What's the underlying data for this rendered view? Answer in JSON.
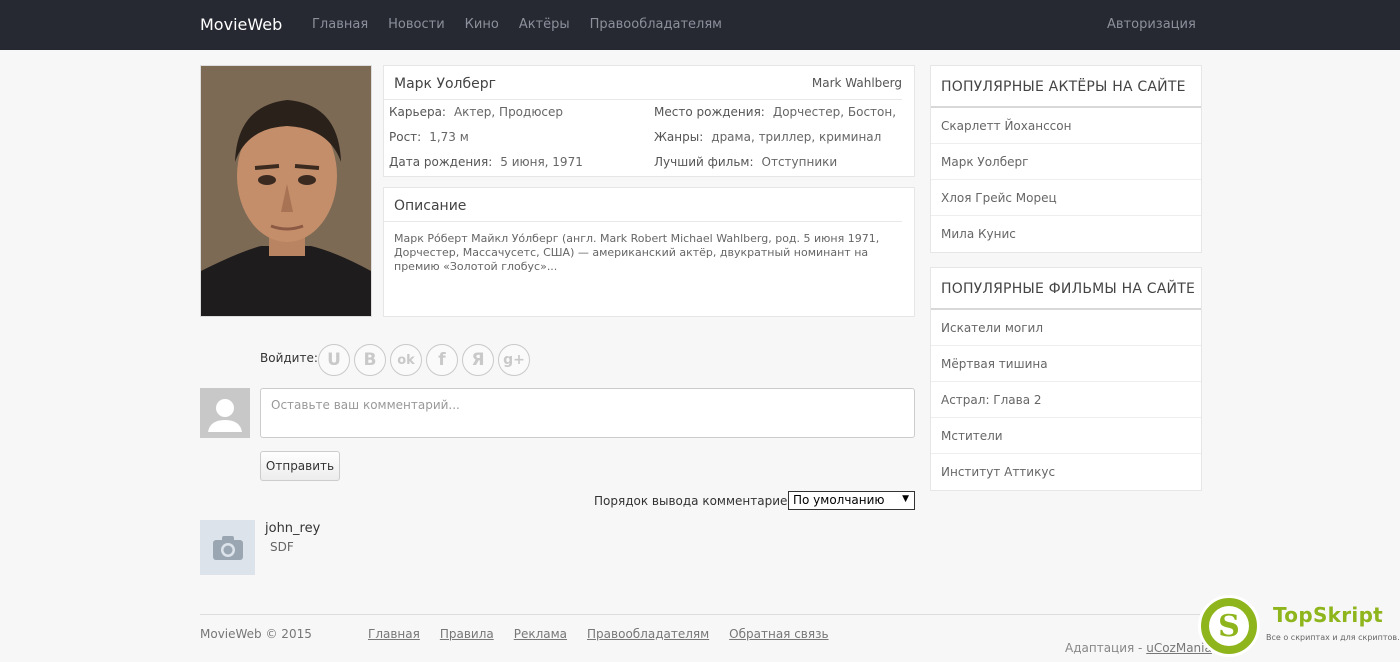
{
  "nav": {
    "brand": "MovieWeb",
    "items": [
      "Главная",
      "Новости",
      "Кино",
      "Актёры",
      "Правообладателям"
    ],
    "auth": "Авторизация"
  },
  "actor": {
    "name": "Марк Уолберг",
    "original_name": "Mark Wahlberg",
    "career_label": "Карьера:",
    "career": "Актер, Продюсер",
    "height_label": "Рост:",
    "height": "1,73 м",
    "birthdate_label": "Дата рождения:",
    "birthdate": "5 июня, 1971",
    "birthplace_label": "Место рождения:",
    "birthplace": "Дорчестер, Бостон,",
    "genres_label": "Жанры:",
    "genres": "драма, триллер, криминал",
    "best_film_label": "Лучший фильм:",
    "best_film": "Отступники"
  },
  "description": {
    "title": "Описание",
    "text": "Марк Ро́берт Майкл Уо́лберг (англ. Mark Robert Michael Wahlberg, род. 5 июня 1971, Дорчестер, Массачусетс, США) — американский актёр, двукратный номинант на премию «Золотой глобус»..."
  },
  "comments": {
    "login_label": "Войдите:",
    "social_icons": [
      {
        "name": "ucoz-icon",
        "glyph": "U"
      },
      {
        "name": "vk-icon",
        "glyph": "B"
      },
      {
        "name": "odnoklassniki-icon",
        "glyph": "ok"
      },
      {
        "name": "facebook-icon",
        "glyph": "f"
      },
      {
        "name": "yandex-icon",
        "glyph": "Я"
      },
      {
        "name": "google-plus-icon",
        "glyph": "g+"
      }
    ],
    "placeholder": "Оставьте ваш комментарий...",
    "submit_label": "Отправить",
    "order_label": "Порядок вывода комментариев:",
    "order_value": "По умолчанию",
    "list": [
      {
        "user": "john_rey",
        "text": "SDF"
      }
    ]
  },
  "sidebar": {
    "actors_title": "ПОПУЛЯРНЫЕ АКТЁРЫ НА САЙТЕ",
    "actors": [
      "Скарлетт Йоханссон",
      "Марк Уолберг",
      "Хлоя Грейс Морец",
      "Мила Кунис"
    ],
    "films_title": "ПОПУЛЯРНЫЕ ФИЛЬМЫ НА САЙТЕ",
    "films": [
      "Искатели могил",
      "Мёртвая тишина",
      "Астрал: Глава 2",
      "Мстители",
      "Институт Аттикус"
    ]
  },
  "footer": {
    "copyright": "MovieWeb © 2015",
    "links": [
      "Главная",
      "Правила",
      "Реклама",
      "Правообладателям",
      "Обратная связь"
    ],
    "adapt_label": "Адаптация -",
    "adapt_link": "uCozMania"
  },
  "watermark": {
    "letter": "S",
    "name": "TopSkript",
    "tagline": "Все о скриптах и для скриптов..."
  },
  "colors": {
    "navbar": "#262932",
    "accent": "#8fb51c"
  }
}
